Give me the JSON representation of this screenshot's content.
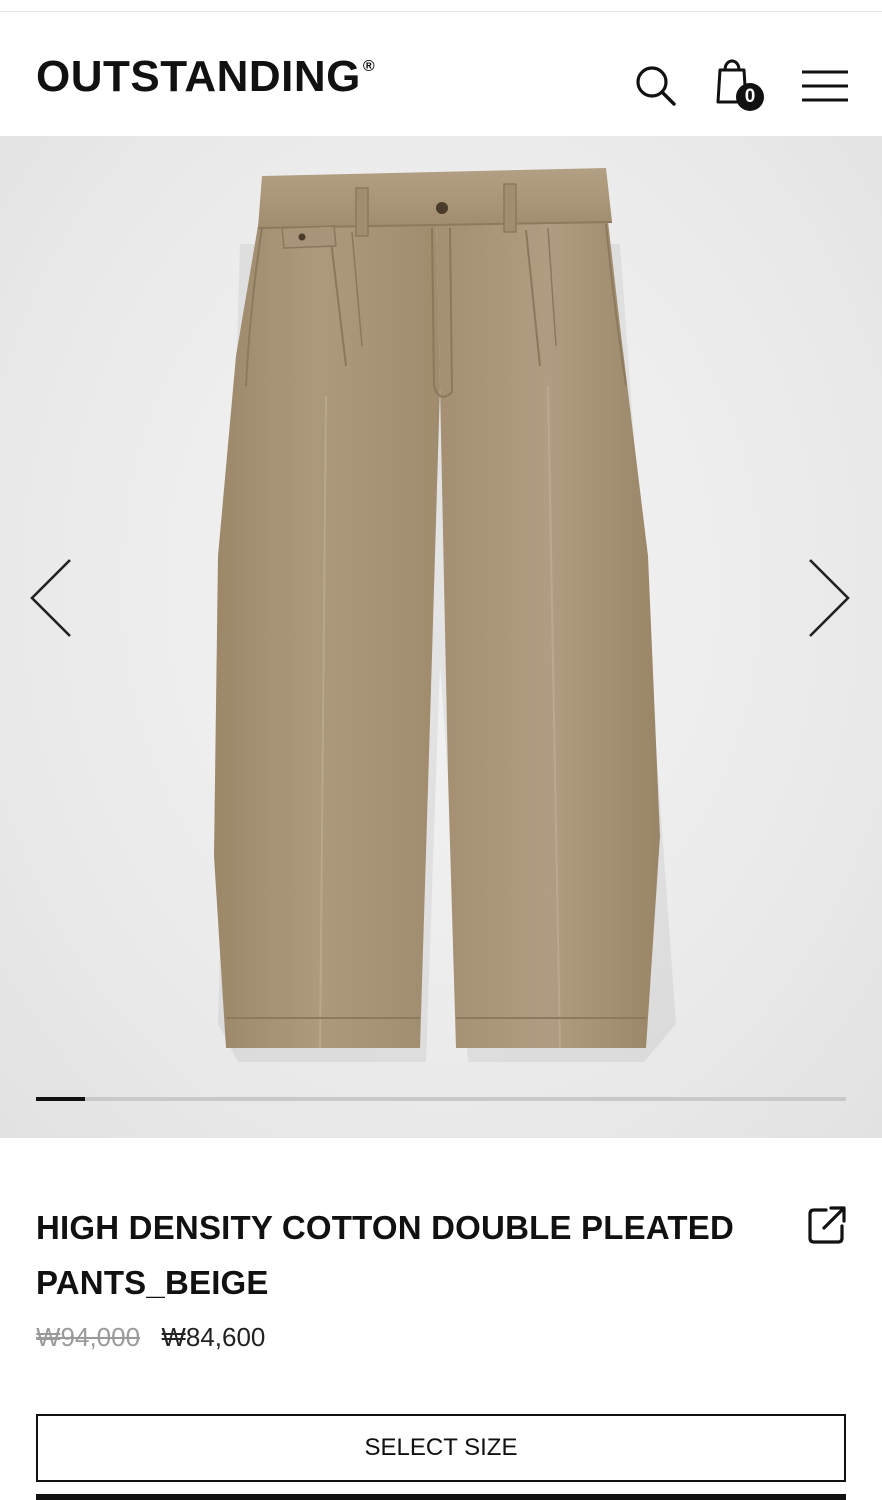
{
  "header": {
    "logo": "OUTSTANDING",
    "logo_mark": "®",
    "icons": {
      "search": "search-icon",
      "cart": "shopping-bag-icon",
      "menu": "hamburger-menu-icon"
    },
    "cart_count": "0"
  },
  "gallery": {
    "image": "beige-pleated-pants-photo",
    "prev_icon": "chevron-left-icon",
    "next_icon": "chevron-right-icon",
    "progress_fraction": 0.06
  },
  "product": {
    "title": "HIGH DENSITY COTTON DOUBLE PLEATED PANTS_BEIGE",
    "price_original": "₩94,000",
    "price_sale": "₩84,600",
    "share_icon": "share-external-icon"
  },
  "actions": {
    "select_size_label": "SELECT SIZE"
  },
  "colors": {
    "accent": "#111111",
    "product_beige": "#a89478",
    "muted_price": "#9a9a9a"
  }
}
